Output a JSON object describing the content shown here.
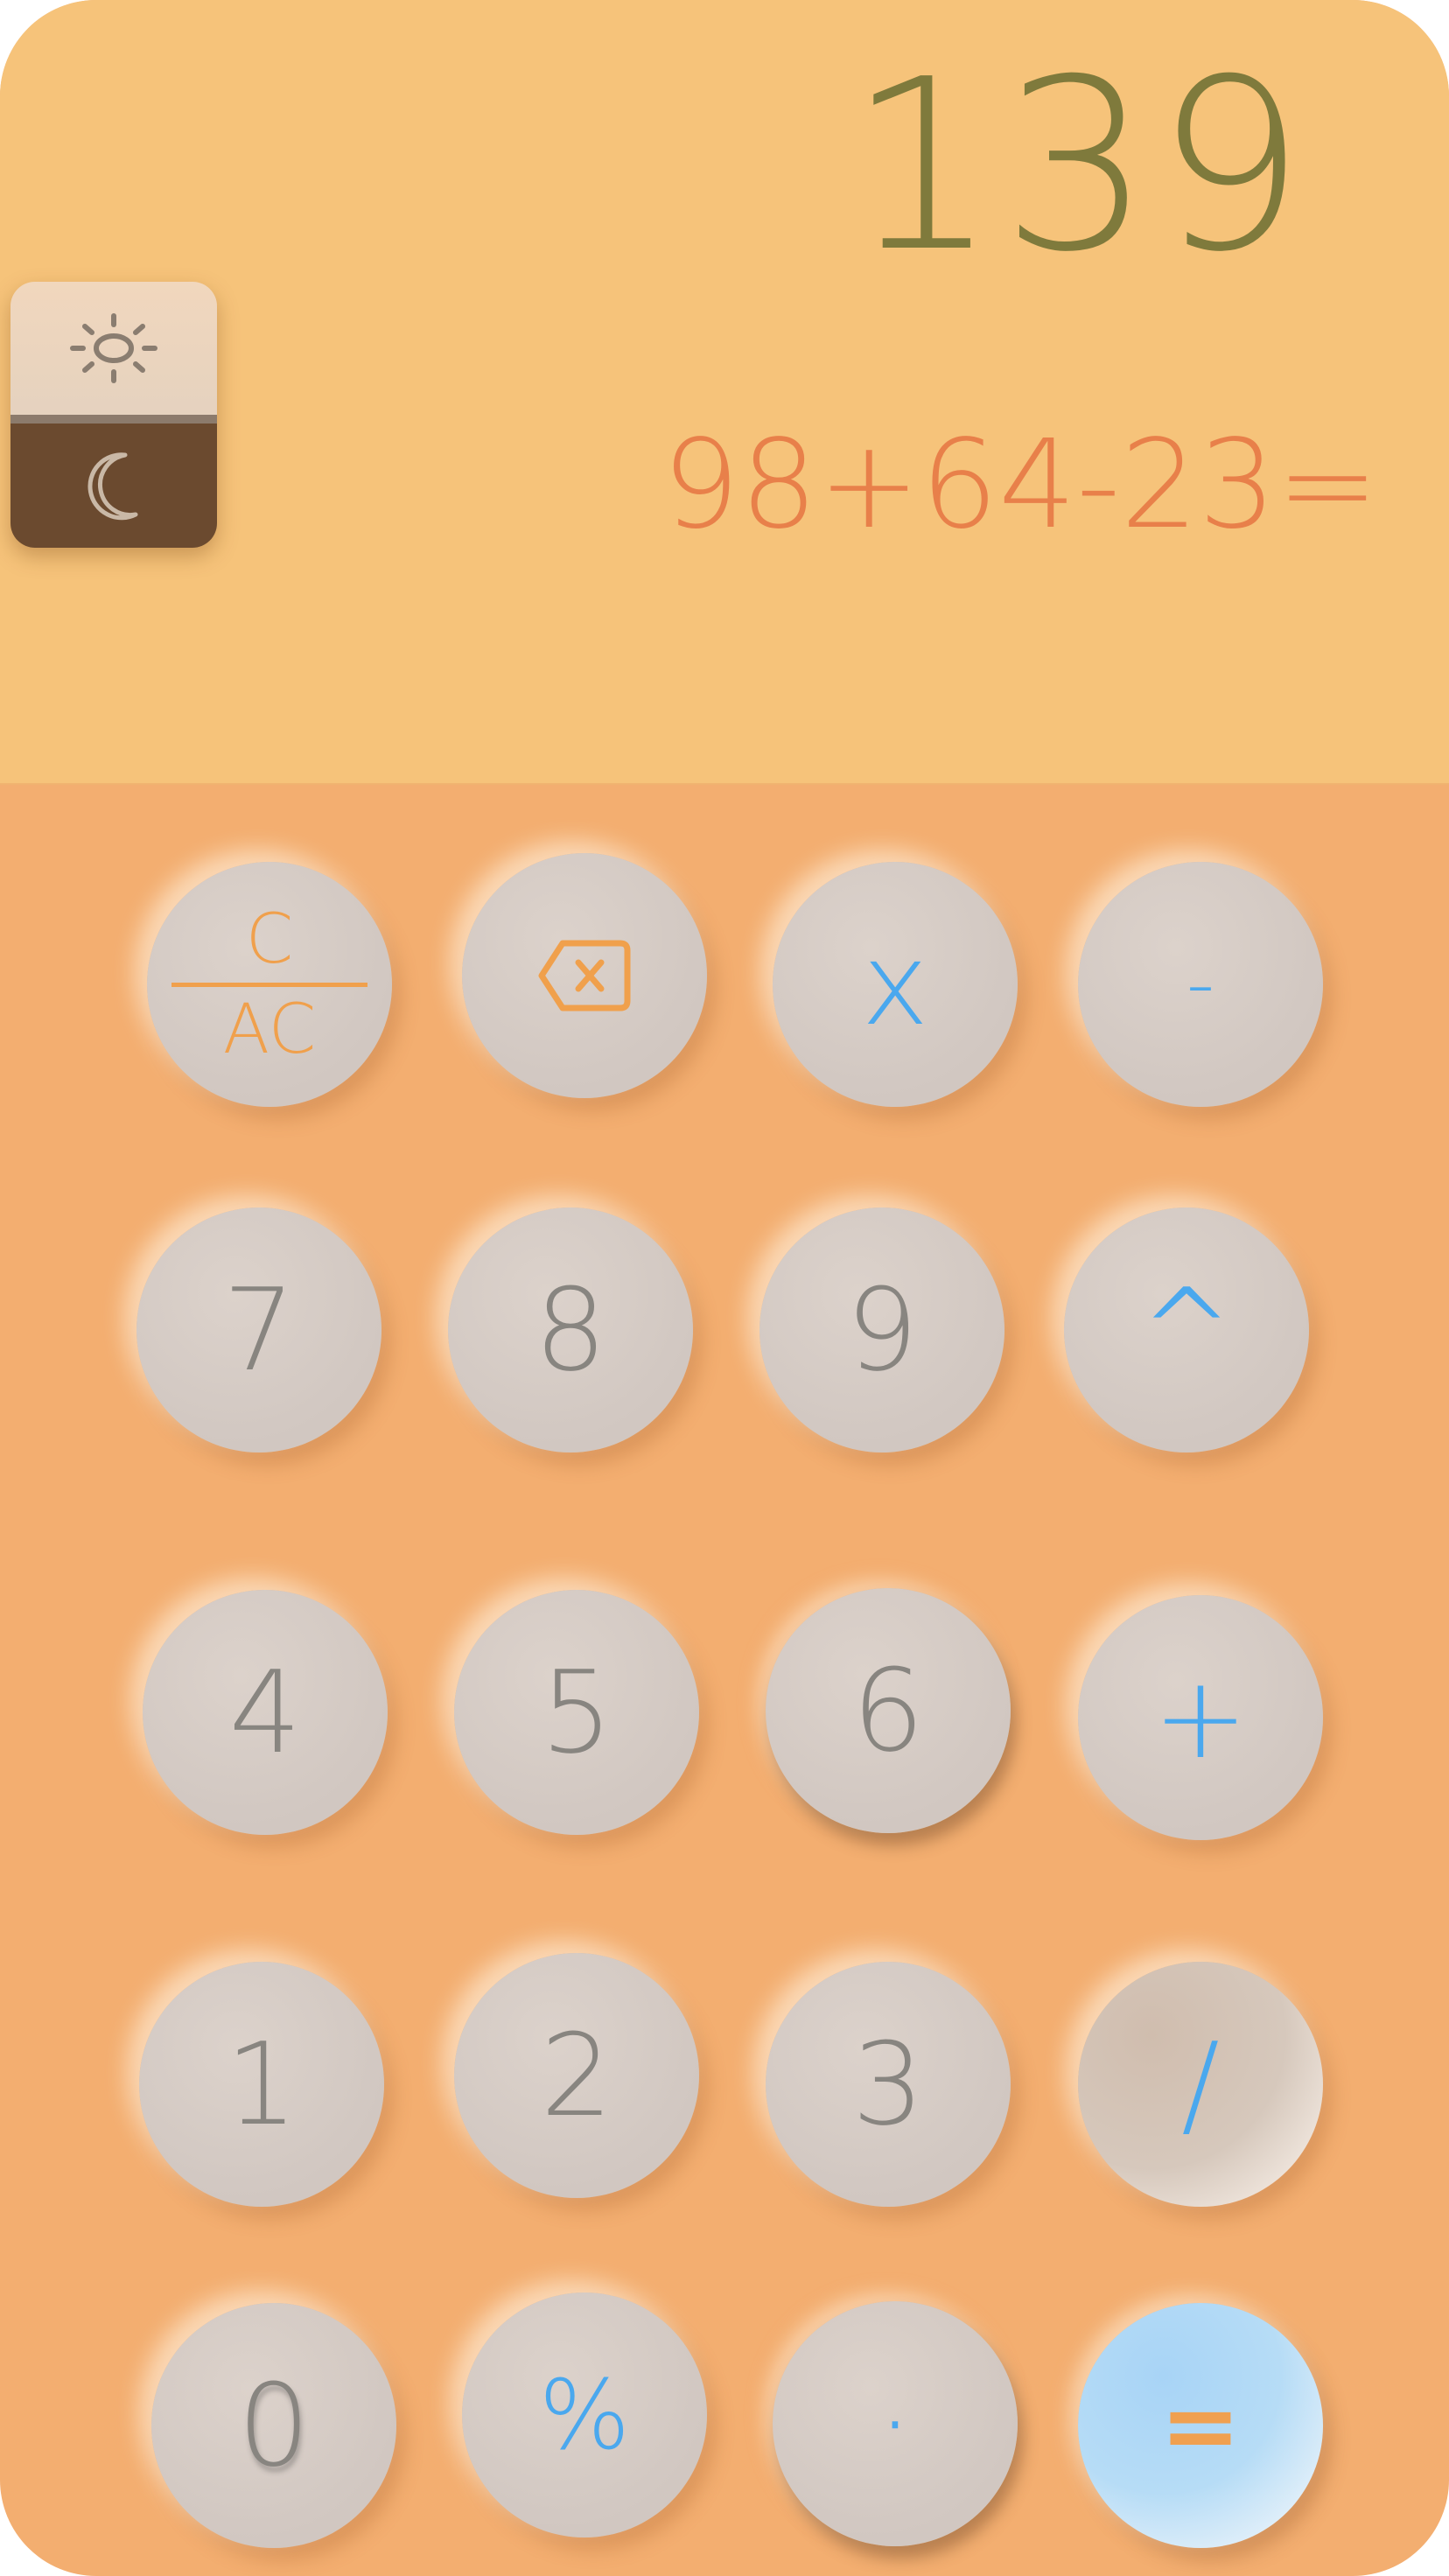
{
  "display": {
    "result": "139",
    "expression": "98+64-23="
  },
  "theme_toggle": {
    "light_icon": "sun-icon",
    "dark_icon": "moon-icon"
  },
  "keypad": {
    "clear_top": "C",
    "clear_bottom": "AC",
    "backspace_icon": "backspace-icon",
    "multiply": "x",
    "subtract": "-",
    "seven": "7",
    "eight": "8",
    "nine": "9",
    "power": "^",
    "four": "4",
    "five": "5",
    "six": "6",
    "add": "+",
    "one": "1",
    "two": "2",
    "three": "3",
    "divide": "/",
    "zero": "0",
    "percent": "%",
    "decimal": "·",
    "equals": "="
  },
  "colors": {
    "display_bg": "#f6c37a",
    "keypad_bg": "#f3ae70",
    "result_text": "#7f7a3c",
    "expression_text": "#e8804a",
    "operator_text": "#4aa8ee",
    "digit_text": "#888580",
    "clear_text": "#f0a04c"
  }
}
